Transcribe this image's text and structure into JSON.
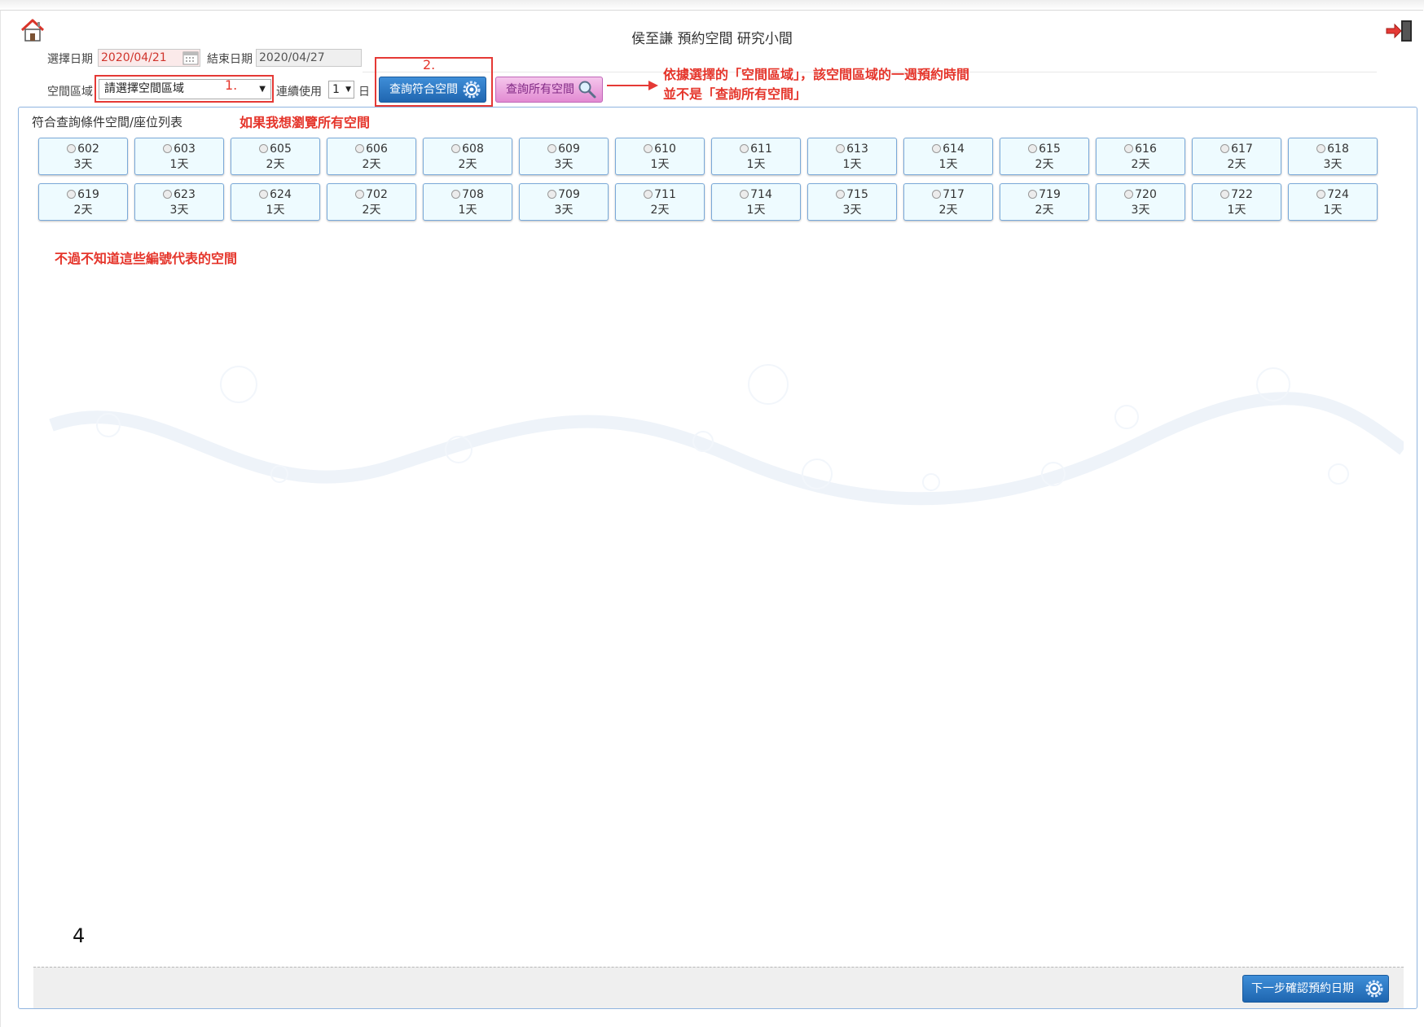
{
  "header": {
    "title": "侯至謙 預約空間 研究小間"
  },
  "form": {
    "start_date_label": "選擇日期",
    "start_date_value": "2020/04/21",
    "end_date_label": "結束日期",
    "end_date_value": "2020/04/27",
    "area_label": "空間區域",
    "area_select_value": "請選擇空間區域",
    "continuous_label": "連續使用",
    "continuous_value": "1",
    "continuous_unit": "日",
    "query_match_button": "查詢符合空間",
    "query_all_button": "查詢所有空間"
  },
  "annotations": {
    "step1": "1.",
    "step2": "2.",
    "arrow_note_line1": "依據選擇的「空間區域」，該空間區域的一週預約時間",
    "arrow_note_line2": "並不是「查詢所有空間」",
    "browse_all_note": "如果我想瀏覽所有空間",
    "numbers_note": "不過不知道這些編號代表的空間",
    "bottom_number": "4"
  },
  "panel": {
    "title": "符合查詢條件空間/座位列表",
    "rooms": [
      {
        "number": "602",
        "days": "3天"
      },
      {
        "number": "603",
        "days": "1天"
      },
      {
        "number": "605",
        "days": "2天"
      },
      {
        "number": "606",
        "days": "2天"
      },
      {
        "number": "608",
        "days": "2天"
      },
      {
        "number": "609",
        "days": "3天"
      },
      {
        "number": "610",
        "days": "1天"
      },
      {
        "number": "611",
        "days": "1天"
      },
      {
        "number": "613",
        "days": "1天"
      },
      {
        "number": "614",
        "days": "1天"
      },
      {
        "number": "615",
        "days": "2天"
      },
      {
        "number": "616",
        "days": "2天"
      },
      {
        "number": "617",
        "days": "2天"
      },
      {
        "number": "618",
        "days": "3天"
      },
      {
        "number": "619",
        "days": "2天"
      },
      {
        "number": "623",
        "days": "3天"
      },
      {
        "number": "624",
        "days": "1天"
      },
      {
        "number": "702",
        "days": "2天"
      },
      {
        "number": "708",
        "days": "1天"
      },
      {
        "number": "709",
        "days": "3天"
      },
      {
        "number": "711",
        "days": "2天"
      },
      {
        "number": "714",
        "days": "1天"
      },
      {
        "number": "715",
        "days": "3天"
      },
      {
        "number": "717",
        "days": "2天"
      },
      {
        "number": "719",
        "days": "2天"
      },
      {
        "number": "720",
        "days": "3天"
      },
      {
        "number": "722",
        "days": "1天"
      },
      {
        "number": "724",
        "days": "1天"
      }
    ]
  },
  "footer": {
    "next_button": "下一步確認預約日期"
  },
  "icons": {
    "home": "home-icon",
    "exit": "exit-icon",
    "calendar": "calendar-icon",
    "gear": "gear-icon",
    "magnifier": "magnifier-icon"
  },
  "colors": {
    "annotation_red": "#e5352b",
    "primary_blue": "#2a78c6",
    "pink_button": "#e9a3dd",
    "room_bg": "#eefbff",
    "panel_border": "#8fb4e0"
  }
}
